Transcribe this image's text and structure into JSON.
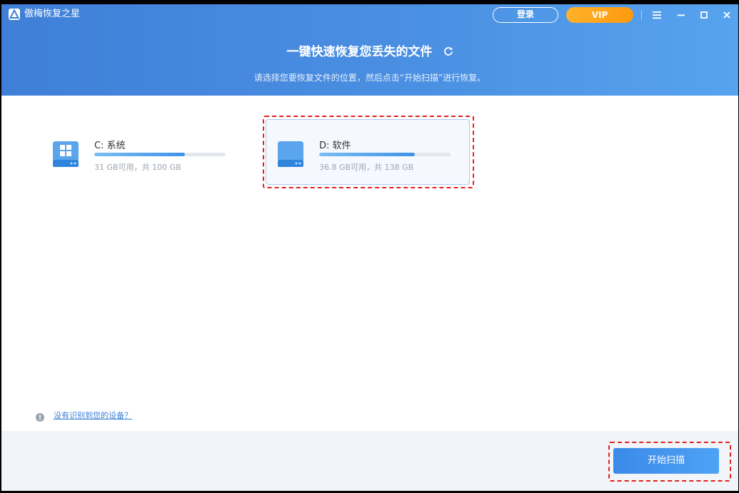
{
  "app": {
    "title": "傲梅恢复之星",
    "login_label": "登录",
    "vip_label": "VIP"
  },
  "header": {
    "headline": "一键快速恢复您丢失的文件",
    "subline": "请选择您要恢复文件的位置，然后点击“开始扫描”进行恢复。"
  },
  "drives": [
    {
      "label": "C: 系统",
      "size_text": "31 GB可用，共 100 GB",
      "used_fraction": 0.69,
      "icon": "windows-drive-icon"
    },
    {
      "label": "D: 软件",
      "size_text": "36.8 GB可用，共 138 GB",
      "used_fraction": 0.73,
      "icon": "drive-icon",
      "selected": true
    }
  ],
  "help": {
    "link_text": "没有识别到您的设备？"
  },
  "footer": {
    "scan_label": "开始扫描"
  },
  "colors": {
    "accent": "#4a8fe2",
    "vip": "#ffa61c",
    "highlight": "#e0231b"
  }
}
